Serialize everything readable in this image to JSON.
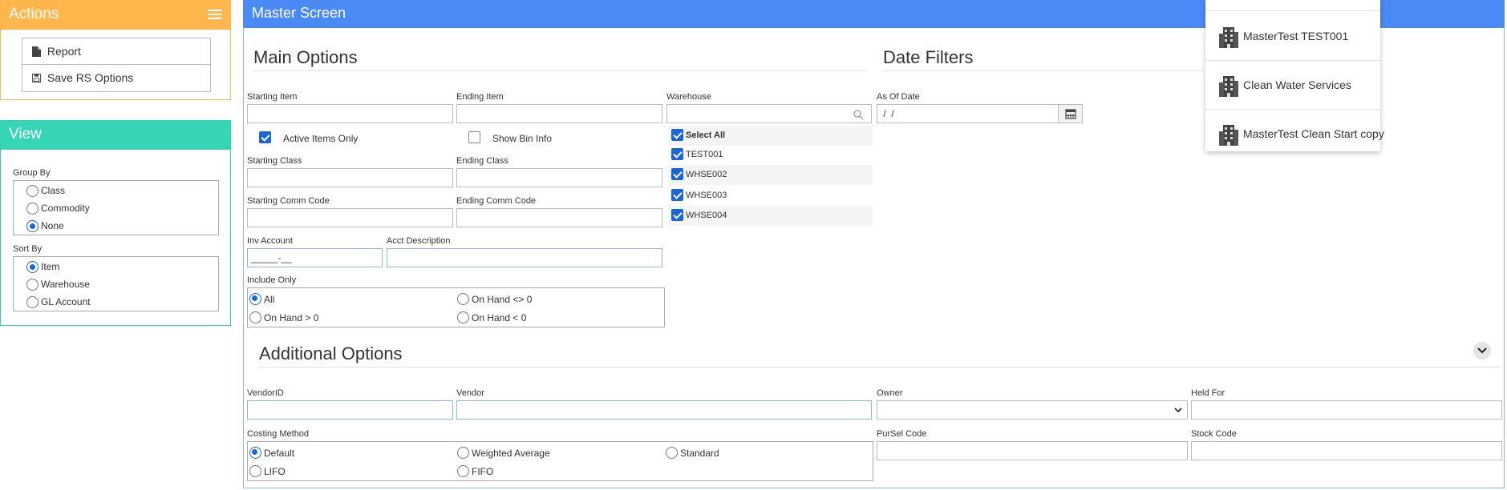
{
  "actions_panel": {
    "title": "Actions",
    "items": [
      {
        "label": "Report",
        "icon": "file-icon"
      },
      {
        "label": "Save RS Options",
        "icon": "save-icon"
      }
    ]
  },
  "view_panel": {
    "title": "View",
    "group_by": {
      "label": "Group By",
      "options": [
        "Class",
        "Commodity",
        "None"
      ],
      "selected": "None"
    },
    "sort_by": {
      "label": "Sort By",
      "options": [
        "Item",
        "Warehouse",
        "GL Account"
      ],
      "selected": "Item"
    }
  },
  "main": {
    "title": "Master Screen",
    "main_options_title": "Main Options",
    "date_filters_title": "Date Filters",
    "additional_options_title": "Additional Options",
    "starting_item": {
      "label": "Starting Item",
      "value": ""
    },
    "ending_item": {
      "label": "Ending Item",
      "value": ""
    },
    "active_items_only": {
      "label": "Active Items Only",
      "checked": true
    },
    "show_bin_info": {
      "label": "Show Bin Info",
      "checked": false
    },
    "starting_class": {
      "label": "Starting Class",
      "value": ""
    },
    "ending_class": {
      "label": "Ending Class",
      "value": ""
    },
    "starting_comm_code": {
      "label": "Starting Comm Code",
      "value": ""
    },
    "ending_comm_code": {
      "label": "Ending Comm Code",
      "value": ""
    },
    "inv_account": {
      "label": "Inv Account",
      "value": "_____-__"
    },
    "acct_description": {
      "label": "Acct Description",
      "value": ""
    },
    "include_only": {
      "label": "Include Only",
      "options": [
        "All",
        "On Hand <> 0",
        "On Hand > 0",
        "On Hand < 0"
      ],
      "selected": "All"
    },
    "warehouse": {
      "label": "Warehouse",
      "search_value": "",
      "select_all_label": "Select All",
      "items": [
        "TEST001",
        "WHSE002",
        "WHSE003",
        "WHSE004"
      ]
    },
    "as_of_date": {
      "label": "As Of Date",
      "value": " /  /"
    },
    "vendor_id": {
      "label": "VendorID",
      "value": ""
    },
    "vendor": {
      "label": "Vendor",
      "value": ""
    },
    "owner": {
      "label": "Owner",
      "value": ""
    },
    "held_for": {
      "label": "Held For",
      "value": ""
    },
    "pursel_code": {
      "label": "PurSel Code",
      "value": ""
    },
    "stock_code": {
      "label": "Stock Code",
      "value": ""
    },
    "costing_method": {
      "label": "Costing Method",
      "options": [
        "Default",
        "Weighted Average",
        "Standard",
        "LIFO",
        "FIFO"
      ],
      "selected": "Default"
    }
  },
  "company_dropdown": {
    "items": [
      "MasterTest TEST001",
      "Clean Water Services",
      "MasterTest Clean Start copy"
    ]
  },
  "colors": {
    "actions_accent": "#ffb74d",
    "view_accent": "#36d6b4",
    "header_blue": "#4a8af4",
    "checkbox_blue": "#1a66d9"
  }
}
